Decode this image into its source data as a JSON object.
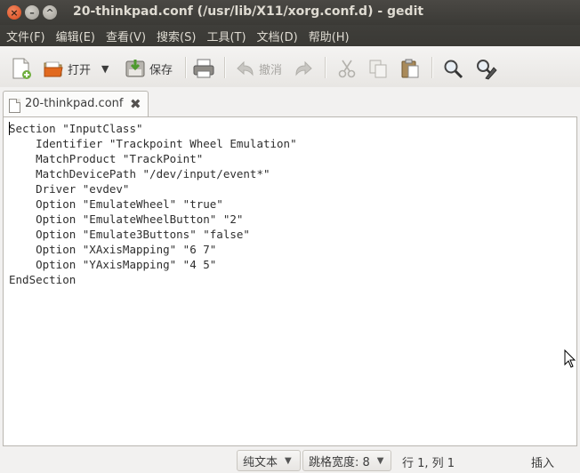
{
  "window": {
    "title": "20-thinkpad.conf (/usr/lib/X11/xorg.conf.d) - gedit",
    "buttons": {
      "close": "×",
      "minimize": "–",
      "maximize": "^"
    }
  },
  "menubar": {
    "items": [
      "文件(F)",
      "编辑(E)",
      "查看(V)",
      "搜索(S)",
      "工具(T)",
      "文档(D)",
      "帮助(H)"
    ]
  },
  "toolbar": {
    "open_label": "打开",
    "save_label": "保存",
    "undo_label": "撤消",
    "dropdown_glyph": "▼"
  },
  "tabs": [
    {
      "label": "20-thinkpad.conf",
      "close_glyph": "✖"
    }
  ],
  "editor": {
    "content": "Section \"InputClass\"\n    Identifier \"Trackpoint Wheel Emulation\"\n    MatchProduct \"TrackPoint\"\n    MatchDevicePath \"/dev/input/event*\"\n    Driver \"evdev\"\n    Option \"EmulateWheel\" \"true\"\n    Option \"EmulateWheelButton\" \"2\"\n    Option \"Emulate3Buttons\" \"false\"\n    Option \"XAxisMapping\" \"6 7\"\n    Option \"YAxisMapping\" \"4 5\"\nEndSection"
  },
  "statusbar": {
    "syntax": "纯文本",
    "tab_width_label": "跳格宽度: 8",
    "position": "行 1, 列 1",
    "insert_mode": "插入",
    "arrow_glyph": "▼"
  },
  "colors": {
    "titlebar_bg": "#3c3b37",
    "close_button": "#e25a24",
    "window_bg": "#f2f1f0",
    "editor_bg": "#ffffff"
  }
}
